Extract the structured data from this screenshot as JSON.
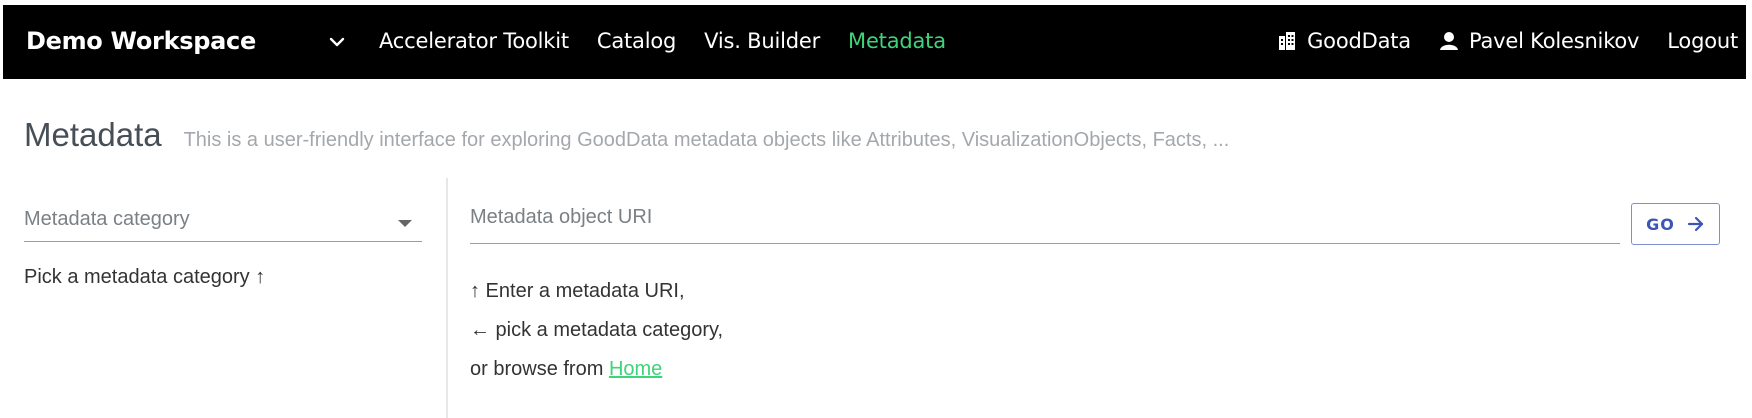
{
  "navbar": {
    "workspace": "Demo Workspace",
    "links": [
      {
        "label": "Accelerator Toolkit",
        "active": false
      },
      {
        "label": "Catalog",
        "active": false
      },
      {
        "label": "Vis. Builder",
        "active": false
      },
      {
        "label": "Metadata",
        "active": true
      }
    ],
    "domain_label": "GoodData",
    "user_name": "Pavel Kolesnikov",
    "logout_label": "Logout",
    "active_color": "#3fd47a"
  },
  "page": {
    "title": "Metadata",
    "subtitle": "This is a user-friendly interface for exploring GoodData metadata objects like Attributes, VisualizationObjects, Facts, ..."
  },
  "left": {
    "select_placeholder": "Metadata category",
    "hint": "Pick a metadata category ↑"
  },
  "right": {
    "uri_placeholder": "Metadata object URI",
    "go_label": "GO",
    "help_line1": "↑ Enter a metadata URI,",
    "help_line2": "← pick a metadata category,",
    "help_line3_prefix": "or browse from ",
    "home_link": "Home"
  }
}
